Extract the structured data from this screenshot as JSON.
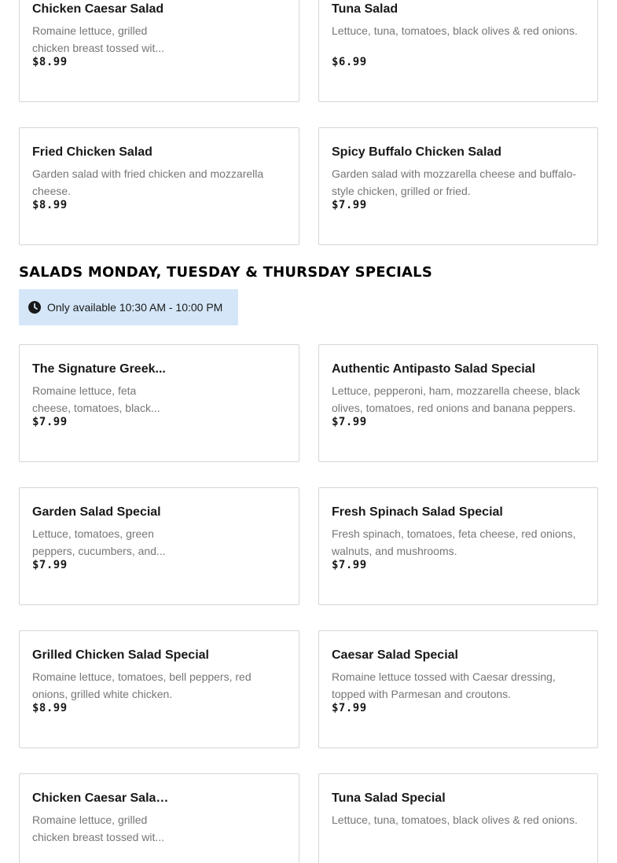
{
  "top_items": [
    {
      "name": "Chicken Caesar Salad",
      "description": "Romaine lettuce, grilled chicken breast tossed wit...",
      "price": "$8.99"
    },
    {
      "name": "Tuna Salad",
      "description": "Lettuce, tuna, tomatoes, black olives & red onions.",
      "price": "$6.99"
    },
    {
      "name": "Fried Chicken Salad",
      "description": "Garden salad with fried chicken and mozzarella cheese.",
      "price": "$8.99"
    },
    {
      "name": "Spicy Buffalo Chicken Salad",
      "description": "Garden salad with mozzarella cheese and buffalo-style chicken, grilled or fried.",
      "price": "$7.99"
    }
  ],
  "section": {
    "title": "SALADS MONDAY, TUESDAY & THURSDAY SPECIALS",
    "availability": "Only available 10:30 AM - 10:00 PM",
    "availability_icon": "clock-icon"
  },
  "special_items": [
    {
      "name": "The Signature Greek...",
      "description": "Romaine lettuce, feta cheese, tomatoes, black...",
      "price": "$7.99"
    },
    {
      "name": "Authentic Antipasto Salad Special",
      "description": "Lettuce, pepperoni, ham, mozzarella cheese, black olives, tomatoes, red onions and banana peppers.",
      "price": "$7.99"
    },
    {
      "name": "Garden Salad Special",
      "description": "Lettuce, tomatoes, green peppers, cucumbers, and...",
      "price": "$7.99"
    },
    {
      "name": "Fresh Spinach Salad Special",
      "description": "Fresh spinach, tomatoes, feta cheese, red onions, walnuts, and mushrooms.",
      "price": "$7.99"
    },
    {
      "name": "Grilled Chicken Salad Special",
      "description": "Romaine lettuce, tomatoes, bell peppers, red onions, grilled white chicken.",
      "price": "$8.99"
    },
    {
      "name": "Caesar Salad Special",
      "description": "Romaine lettuce tossed with Caesar dressing, topped with Parmesan and croutons.",
      "price": "$7.99"
    },
    {
      "name": "Chicken Caesar Salad...",
      "description": "Romaine lettuce, grilled chicken breast tossed wit...",
      "price": ""
    },
    {
      "name": "Tuna Salad Special",
      "description": "Lettuce, tuna, tomatoes, black olives & red onions.",
      "price": ""
    }
  ],
  "colors": {
    "availability_bg": "#d4e6f7",
    "border": "#d6d6d6",
    "description_text": "#767676"
  }
}
